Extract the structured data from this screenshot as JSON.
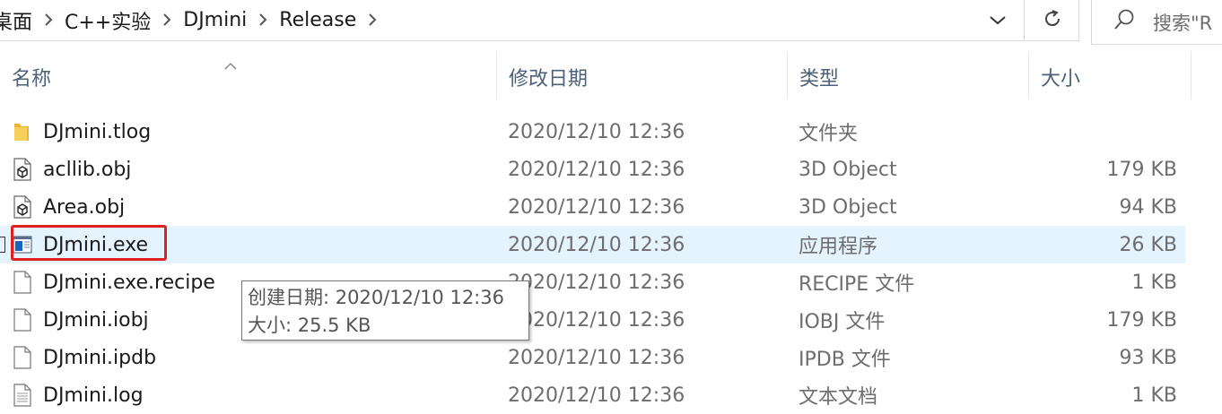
{
  "breadcrumb": {
    "items": [
      "桌面",
      "C++实验",
      "DJmini",
      "Release"
    ]
  },
  "search": {
    "placeholder": "搜索\"R"
  },
  "columns": {
    "name": "名称",
    "modified": "修改日期",
    "type": "类型",
    "size": "大小",
    "sort_column": "name",
    "sort_direction": "ascending"
  },
  "files": [
    {
      "name": "DJmini.tlog",
      "modified": "2020/12/10 12:36",
      "type": "文件夹",
      "size": "",
      "icon": "folder-icon"
    },
    {
      "name": "acllib.obj",
      "modified": "2020/12/10 12:36",
      "type": "3D Object",
      "size": "179 KB",
      "icon": "3d-object-file-icon"
    },
    {
      "name": "Area.obj",
      "modified": "2020/12/10 12:36",
      "type": "3D Object",
      "size": "94 KB",
      "icon": "3d-object-file-icon"
    },
    {
      "name": "DJmini.exe",
      "modified": "2020/12/10 12:36",
      "type": "应用程序",
      "size": "26 KB",
      "icon": "application-icon",
      "selected": true
    },
    {
      "name": "DJmini.exe.recipe",
      "modified": "2020/12/10 12:36",
      "type": "RECIPE 文件",
      "size": "1 KB",
      "icon": "blank-file-icon"
    },
    {
      "name": "DJmini.iobj",
      "modified": "2020/12/10 12:36",
      "type": "IOBJ 文件",
      "size": "179 KB",
      "icon": "blank-file-icon"
    },
    {
      "name": "DJmini.ipdb",
      "modified": "2020/12/10 12:36",
      "type": "IPDB 文件",
      "size": "93 KB",
      "icon": "blank-file-icon"
    },
    {
      "name": "DJmini.log",
      "modified": "2020/12/10 12:36",
      "type": "文本文档",
      "size": "1 KB",
      "icon": "text-document-icon"
    }
  ],
  "tooltip": {
    "line1": "创建日期: 2020/12/10 12:36",
    "line2": "大小: 25.5 KB"
  },
  "colors": {
    "selection": "#e5f3ff",
    "highlight_box": "#e02020",
    "header_text": "#4c607a",
    "folder": "#f4c34d",
    "app_icon": "#1565c0"
  }
}
